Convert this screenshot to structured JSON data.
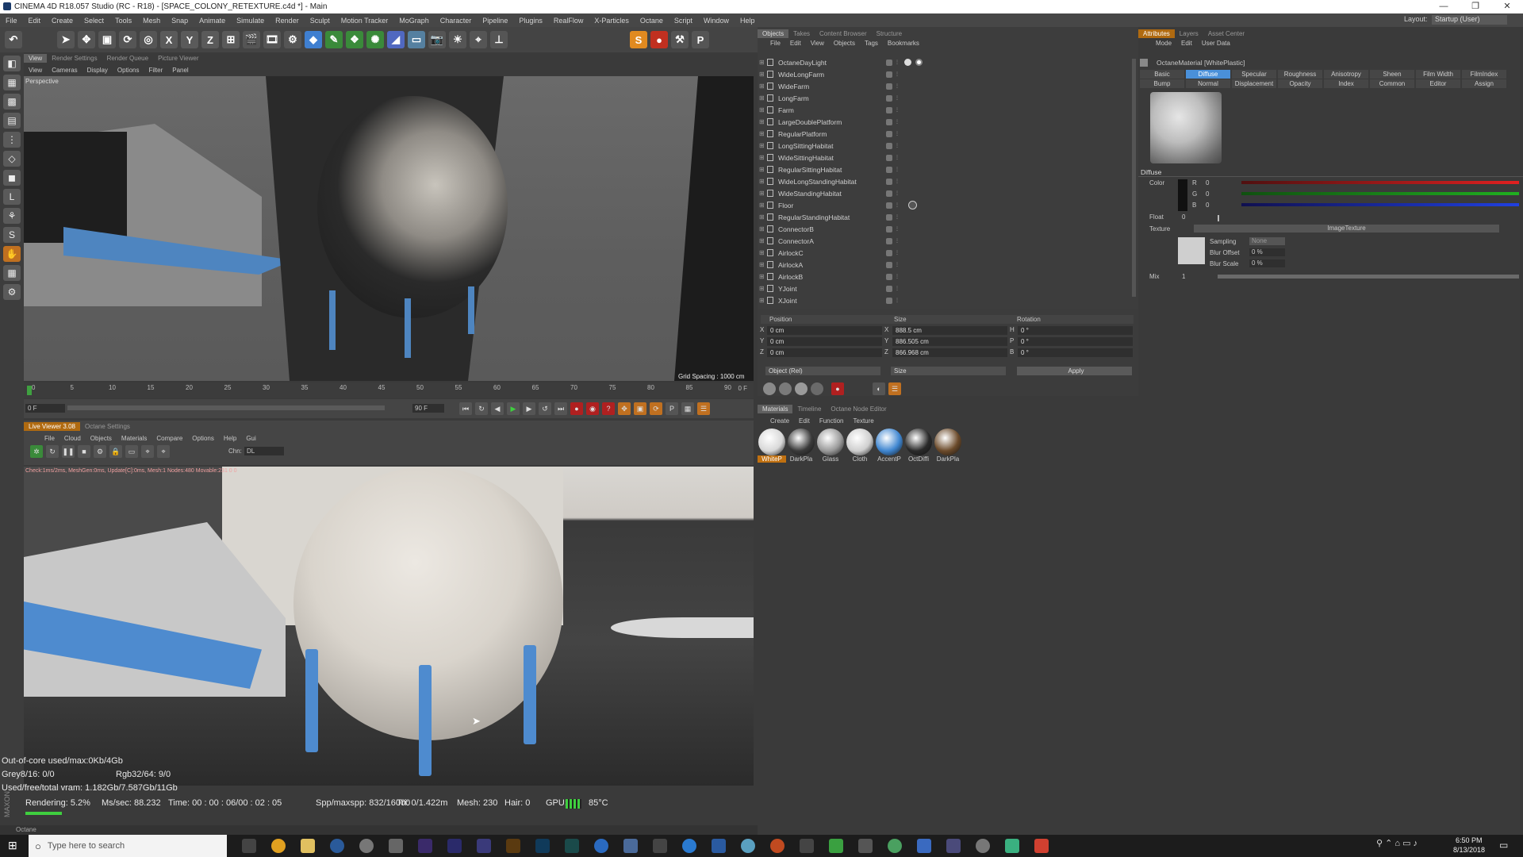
{
  "window": {
    "title": "CINEMA 4D R18.057 Studio (RC - R18) - [SPACE_COLONY_RETEXTURE.c4d *] - Main"
  },
  "menu": [
    "File",
    "Edit",
    "Create",
    "Select",
    "Tools",
    "Mesh",
    "Snap",
    "Animate",
    "Simulate",
    "Render",
    "Sculpt",
    "Motion Tracker",
    "MoGraph",
    "Character",
    "Pipeline",
    "Plugins",
    "RealFlow",
    "X-Particles",
    "Octane",
    "Script",
    "Window",
    "Help"
  ],
  "layout": {
    "label": "Layout:",
    "value": "Startup (User)"
  },
  "viewport_tabs": [
    "View",
    "Render Settings",
    "Render Queue",
    "Picture Viewer"
  ],
  "viewport_menu": [
    "View",
    "Cameras",
    "Display",
    "Options",
    "Filter",
    "Panel"
  ],
  "viewport_label": "Perspective",
  "grid_spacing": "Grid Spacing : 1000 cm",
  "timeline": {
    "ticks": [
      "0",
      "5",
      "10",
      "15",
      "20",
      "25",
      "30",
      "35",
      "40",
      "45",
      "50",
      "55",
      "60",
      "65",
      "70",
      "75",
      "80",
      "85",
      "90"
    ],
    "end": "0 F",
    "start_frame": "0 F",
    "end_frame": "90 F"
  },
  "live_viewer": {
    "tabs": [
      "Live Viewer 3.08",
      "Octane Settings"
    ],
    "menu": [
      "File",
      "Cloud",
      "Objects",
      "Materials",
      "Compare",
      "Options",
      "Help",
      "Gui"
    ],
    "chn_label": "Chn:",
    "chn_value": "DL",
    "check": "Check:1ms/2ms, MeshGen:0ms, Update[C]:0ms, Mesh:1 Nodes:480 Movable:231 0 0"
  },
  "render_stats": {
    "line1": "Out-of-core used/max:0Kb/4Gb",
    "grey": "Grey8/16: 0/0",
    "rgb": "Rgb32/64: 9/0",
    "vram": "Used/free/total vram: 1.182Gb/7.587Gb/11Gb",
    "rendering": "Rendering: 5.2%",
    "mssec": "Ms/sec: 88.232",
    "time": "Time: 00 : 00 : 06/00 : 02 : 05",
    "spp": "Spp/maxspp: 832/16000",
    "tri": "Tri: 0/1.422m",
    "mesh": "Mesh: 230",
    "hair": "Hair: 0",
    "gpu": "GPU:",
    "temp": "85°C"
  },
  "status_line": "Octane",
  "objects": {
    "tabs": [
      "Objects",
      "Takes",
      "Content Browser",
      "Structure"
    ],
    "menu": [
      "File",
      "Edit",
      "View",
      "Objects",
      "Tags",
      "Bookmarks"
    ],
    "items": [
      "OctaneDayLight",
      "WideLongFarm",
      "WideFarm",
      "LongFarm",
      "Farm",
      "LargeDoublePlatform",
      "RegularPlatform",
      "LongSittingHabitat",
      "WideSittingHabitat",
      "RegularSittingHabitat",
      "WideLongStandingHabitat",
      "WideStandingHabitat",
      "Floor",
      "RegularStandingHabitat",
      "ConnectorB",
      "ConnectorA",
      "AirlockC",
      "AirlockA",
      "AirlockB",
      "YJoint",
      "XJoint"
    ]
  },
  "coords": {
    "headers": [
      "Position",
      "Size",
      "Rotation"
    ],
    "rows": [
      {
        "a": "X",
        "pos": "0 cm",
        "b": "X",
        "size": "888.5 cm",
        "c": "H",
        "rot": "0 °"
      },
      {
        "a": "Y",
        "pos": "0 cm",
        "b": "Y",
        "size": "886.505 cm",
        "c": "P",
        "rot": "0 °"
      },
      {
        "a": "Z",
        "pos": "0 cm",
        "b": "Z",
        "size": "866.968 cm",
        "c": "B",
        "rot": "0 °"
      }
    ],
    "mode": "Object (Rel)",
    "size_mode": "Size",
    "apply": "Apply"
  },
  "materials": {
    "tabs": [
      "Materials",
      "Timeline",
      "Octane Node Editor"
    ],
    "menu": [
      "Create",
      "Edit",
      "Function",
      "Texture"
    ],
    "items": [
      {
        "name": "WhiteP",
        "color": "#d8d8d8"
      },
      {
        "name": "DarkPla",
        "color": "#3a3a3a"
      },
      {
        "name": "Glass",
        "color": "#9a9a9a"
      },
      {
        "name": "Cloth",
        "color": "#cfcfcf"
      },
      {
        "name": "AccentP",
        "color": "#3f86d0"
      },
      {
        "name": "OctDiffi",
        "color": "#2a2a2a"
      },
      {
        "name": "DarkPla",
        "color": "#6b4a2a"
      }
    ]
  },
  "attributes": {
    "tabs": [
      "Attributes",
      "Layers",
      "Asset Center"
    ],
    "menu": [
      "Mode",
      "Edit",
      "User Data"
    ],
    "title": "OctaneMaterial [WhitePlastic]",
    "row1": [
      "Basic",
      "Diffuse",
      "Specular",
      "Roughness",
      "Anisotropy",
      "Sheen",
      "Film Width",
      "FilmIndex"
    ],
    "row2": [
      "Bump",
      "Normal",
      "Displacement",
      "Opacity",
      "Index",
      "Common",
      "Editor",
      "Assign"
    ],
    "section": "Diffuse",
    "color_label": "Color",
    "r_label": "R",
    "r": "0",
    "g_label": "G",
    "g": "0",
    "b_label": "B",
    "b": "0",
    "float_label": "Float",
    "float": "0",
    "texture_label": "Texture",
    "texture": "ImageTexture",
    "sampling_label": "Sampling",
    "sampling": "None",
    "blur_offset_label": "Blur Offset",
    "blur_offset": "0 %",
    "blur_scale_label": "Blur Scale",
    "blur_scale": "0 %",
    "mix_label": "Mix",
    "mix": "1"
  },
  "taskbar": {
    "search": "Type here to search",
    "time": "6:50 PM",
    "date": "8/13/2018"
  },
  "colors": {
    "accent": "#4a90d9",
    "red": "#e02020",
    "green": "#20b020",
    "blue": "#2040e0"
  }
}
